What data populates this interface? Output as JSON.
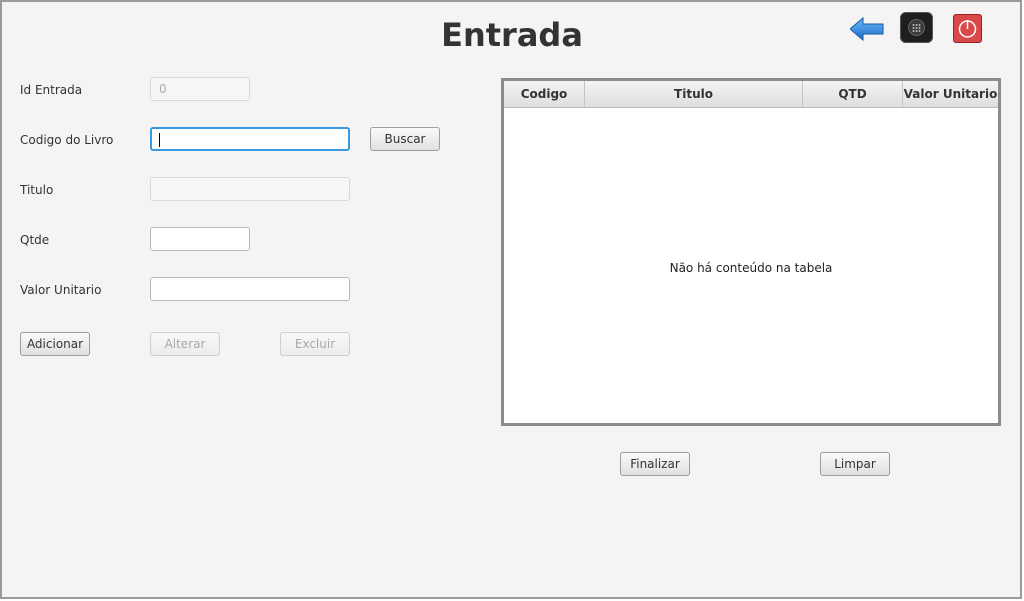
{
  "header": {
    "title": "Entrada"
  },
  "icons": {
    "back": "arrow-left-icon",
    "menu": "apps-icon",
    "exit": "power-icon"
  },
  "form": {
    "id_label": "Id Entrada",
    "id_value": "0",
    "codigo_label": "Codigo do Livro",
    "codigo_value": "",
    "buscar_label": "Buscar",
    "titulo_label": "Titulo",
    "titulo_value": "",
    "qtde_label": "Qtde",
    "qtde_value": "",
    "valor_label": "Valor Unitario",
    "valor_value": ""
  },
  "actions": {
    "adicionar": "Adicionar",
    "alterar": "Alterar",
    "excluir": "Excluir"
  },
  "table": {
    "columns": [
      "Codigo",
      "Titulo",
      "QTD",
      "Valor Unitario"
    ],
    "empty_message": "Não há conteúdo na tabela"
  },
  "footer": {
    "finalizar": "Finalizar",
    "limpar": "Limpar"
  },
  "colors": {
    "accent_focus": "#3a9ae0",
    "back_arrow": "#2a7fd4",
    "exit_button": "#d84a4a"
  }
}
